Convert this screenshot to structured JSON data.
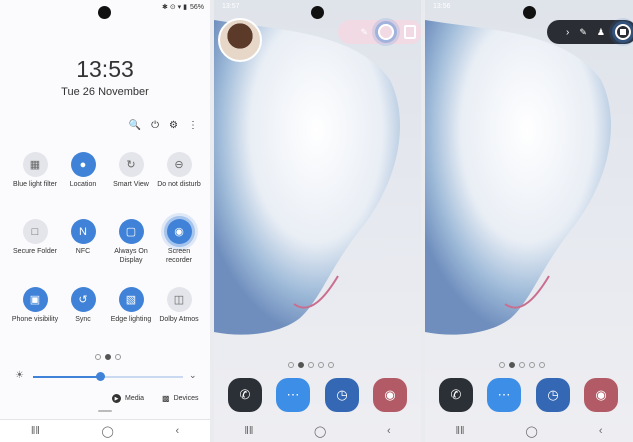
{
  "panel1": {
    "status": {
      "icons": "✱ ⊙ ▾ ▮",
      "battery": "56%"
    },
    "clock": {
      "time": "13:53",
      "date": "Tue 26 November"
    },
    "tools": [
      "search-icon",
      "power-icon",
      "gear-icon",
      "more-icon"
    ],
    "tiles": [
      {
        "label": "Blue light filter",
        "state": "off",
        "icon": "blue-light-icon"
      },
      {
        "label": "Location",
        "state": "on",
        "icon": "location-icon"
      },
      {
        "label": "Smart View",
        "state": "off",
        "icon": "smart-view-icon"
      },
      {
        "label": "Do not disturb",
        "state": "off",
        "icon": "dnd-icon"
      },
      {
        "label": "Secure Folder",
        "state": "off",
        "icon": "folder-icon"
      },
      {
        "label": "NFC",
        "state": "on",
        "icon": "nfc-icon"
      },
      {
        "label": "Always On Display",
        "state": "on",
        "icon": "display-icon"
      },
      {
        "label": "Screen recorder",
        "state": "on",
        "icon": "screen-recorder-icon"
      },
      {
        "label": "Phone visibility",
        "state": "on",
        "icon": "phone-visibility-icon"
      },
      {
        "label": "Sync",
        "state": "on",
        "icon": "sync-icon"
      },
      {
        "label": "Edge lighting",
        "state": "on",
        "icon": "edge-lighting-icon"
      },
      {
        "label": "Dolby Atmos",
        "state": "off",
        "icon": "dolby-icon"
      }
    ],
    "brightness": {
      "level_fraction": 0.45
    },
    "media_label": "Media",
    "devices_label": "Devices"
  },
  "panel2": {
    "status_time": "13:57"
  },
  "panel3": {
    "status_time": "13:56"
  },
  "colors": {
    "accent": "#3f82d8",
    "dock_phone": "#2b3036",
    "dock_messages": "#3d8ee6",
    "dock_clock": "#3468b4",
    "dock_camera": "#b25b66"
  }
}
